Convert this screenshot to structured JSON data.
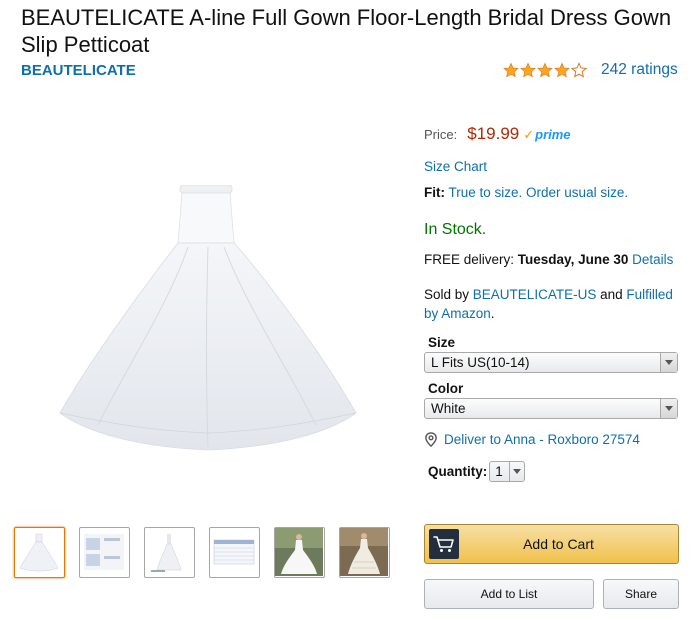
{
  "product": {
    "title": "BEAUTELICATE A-line Full Gown Floor-Length Bridal Dress Gown Slip Petticoat",
    "brand": "BEAUTELICATE",
    "rating_stars": 4.0,
    "rating_count": "242 ratings"
  },
  "buybox": {
    "price_label": "Price:",
    "price": "$19.99",
    "prime_label": "prime",
    "size_chart": "Size Chart",
    "fit_label": "Fit:",
    "fit_value": "True to size. Order usual size.",
    "stock": "In Stock.",
    "delivery_prefix": "FREE delivery:",
    "delivery_date": "Tuesday, June 30",
    "delivery_details": "Details",
    "sold_by_prefix": "Sold by",
    "seller": "BEAUTELICATE-US",
    "and_text": "and",
    "fulfilled": "Fulfilled by Amazon",
    "sold_suffix": ".",
    "size_label": "Size",
    "size_value": "L Fits US(10-14)",
    "color_label": "Color",
    "color_value": "White",
    "deliver_to": "Deliver to Anna - Roxboro 27574",
    "quantity_label": "Quantity:",
    "quantity_value": "1",
    "add_to_cart": "Add to Cart",
    "add_to_list": "Add to List",
    "share": "Share"
  },
  "colors": {
    "link": "#0f6fad",
    "price": "#b12704",
    "in_stock": "#007600",
    "add_to_cart_bg": "#f0c14b",
    "selected_thumb_border": "#e77600"
  }
}
